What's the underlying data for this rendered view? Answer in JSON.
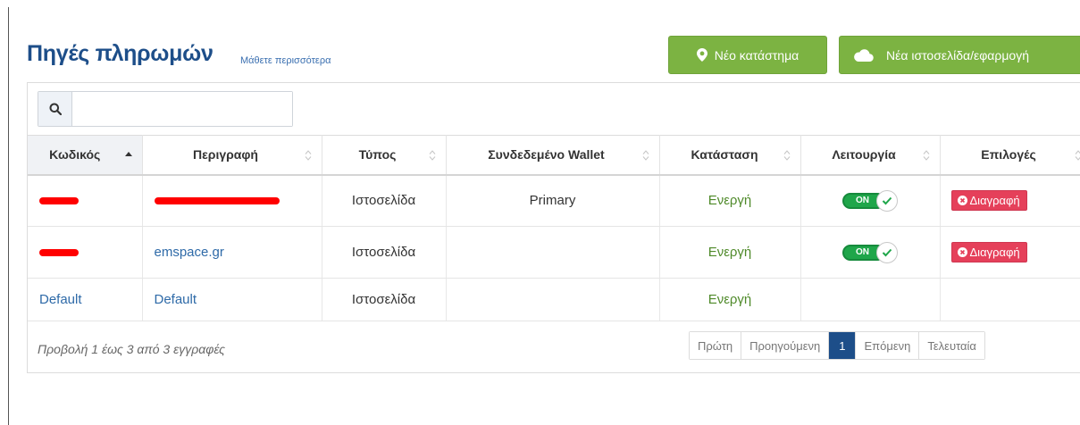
{
  "header": {
    "title": "Πηγές πληρωμών",
    "learn_more": "Μάθετε περισσότερα",
    "new_store_label": "Νέο κατάστημα",
    "new_web_label": "Νέα ιστοσελίδα/εφαρμογή"
  },
  "search": {
    "value": "",
    "placeholder": ""
  },
  "table": {
    "columns": [
      "Κωδικός",
      "Περιγραφή",
      "Τύπος",
      "Συνδεδεμένο Wallet",
      "Κατάσταση",
      "Λειτουργία",
      "Επιλογές"
    ],
    "rows": [
      {
        "code": "",
        "description": "",
        "type": "Ιστοσελίδα",
        "wallet": "Primary",
        "status": "Ενεργή",
        "toggle": "ON",
        "delete": "Διαγραφή"
      },
      {
        "code": "",
        "description": "emspace.gr",
        "type": "Ιστοσελίδα",
        "wallet": "",
        "status": "Ενεργή",
        "toggle": "ON",
        "delete": "Διαγραφή"
      },
      {
        "code": "Default",
        "description": "Default",
        "type": "Ιστοσελίδα",
        "wallet": "",
        "status": "Ενεργή",
        "toggle": "",
        "delete": ""
      }
    ]
  },
  "footer": {
    "info": "Προβολή 1 έως 3 από 3 εγγραφές",
    "pages": [
      "Πρώτη",
      "Προηγούμενη",
      "1",
      "Επόμενη",
      "Τελευταία"
    ]
  },
  "colors": {
    "brand": "#1d4e89",
    "green_button": "#7cb342",
    "toggle_on": "#1fa64a",
    "delete": "#e5405a",
    "redaction": "#ff0000"
  },
  "icons": [
    "map-marker-icon",
    "cloud-icon",
    "search-icon",
    "sort-asc-icon",
    "sort-icon",
    "check-icon",
    "close-circle-icon"
  ]
}
